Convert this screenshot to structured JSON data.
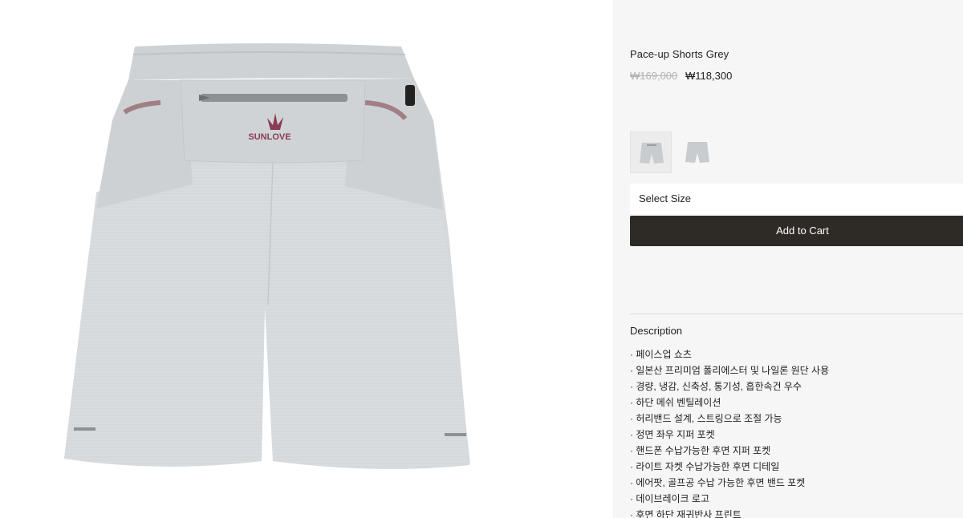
{
  "product": {
    "title": "Pace-up Shorts Grey",
    "price_original": "₩169,000",
    "price_sale": "₩118,300",
    "brand_logo_text": "SUNLOVE"
  },
  "thumbnails": [
    {
      "name": "thumbnail-back-view",
      "selected": true
    },
    {
      "name": "thumbnail-front-view",
      "selected": false
    }
  ],
  "size_select": {
    "label": "Select Size"
  },
  "cart": {
    "add_label": "Add to Cart"
  },
  "description": {
    "heading": "Description",
    "items": [
      "· 페이스업 쇼츠",
      "· 일본산 프리미엄 폴리에스터 및 나일론 원단 사용",
      "· 경량, 냉감, 신축성, 통기성,  흡한속건 우수",
      "· 하단 메쉬 벤틸레이션",
      "· 허리밴드 설계, 스트링으로 조절 가능",
      "· 정면 좌우 지퍼 포켓",
      "· 핸드폰 수납가능한 후면 지퍼 포켓",
      "· 라이트 자켓 수납가능한 후면 디테일",
      "· 에어팟, 골프공 수납 가능한 후면 밴드 포켓",
      "· 데이브레이크 로고",
      "· 후면 하단 재귀반사 프린트"
    ]
  },
  "colors": {
    "panel_bg": "#f6f6f6",
    "button_bg": "#2e2b26",
    "shorts_main": "#d5d8da",
    "logo": "#8a3b55"
  }
}
